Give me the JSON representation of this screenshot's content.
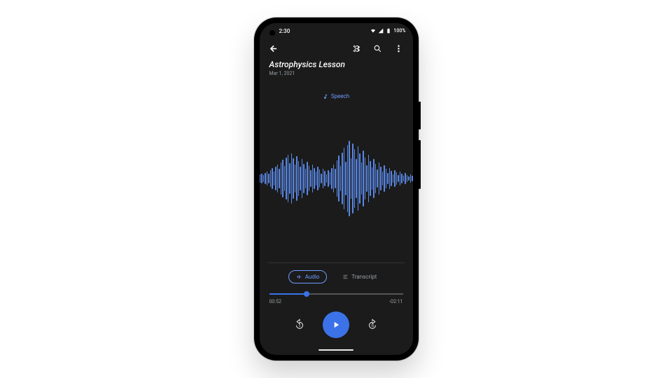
{
  "statusbar": {
    "time": "2:30",
    "battery": "100%"
  },
  "recording": {
    "title": "Astrophysics Lesson",
    "date": "Mar 1, 2021"
  },
  "speech_chip": "Speech",
  "tabs": {
    "audio": "Audio",
    "transcript": "Transcript",
    "active": "audio"
  },
  "playback": {
    "elapsed": "00:52",
    "remaining": "-02:11",
    "progress_percent": 28
  },
  "waveform": {
    "bars": [
      6,
      8,
      10,
      8,
      12,
      14,
      10,
      16,
      20,
      14,
      24,
      30,
      20,
      34,
      40,
      28,
      46,
      54,
      36,
      60,
      68,
      44,
      72,
      58,
      40,
      64,
      50,
      34,
      56,
      42,
      28,
      48,
      36,
      24,
      40,
      30,
      20,
      34,
      26,
      14,
      28,
      22,
      12,
      24,
      18,
      30,
      40,
      28,
      52,
      66,
      36,
      74,
      88,
      48,
      96,
      108,
      58,
      100,
      84,
      56,
      92,
      72,
      46,
      80,
      60,
      38,
      68,
      50,
      32,
      56,
      42,
      26,
      46,
      34,
      20,
      38,
      28,
      16,
      30,
      22,
      12,
      24,
      18,
      10,
      20,
      14,
      8,
      16,
      10,
      6,
      12,
      8,
      5,
      10,
      6,
      4
    ]
  },
  "colors": {
    "accent": "#3b72e8",
    "accent_light": "#6f9bff",
    "bg": "#1b1b1b"
  }
}
